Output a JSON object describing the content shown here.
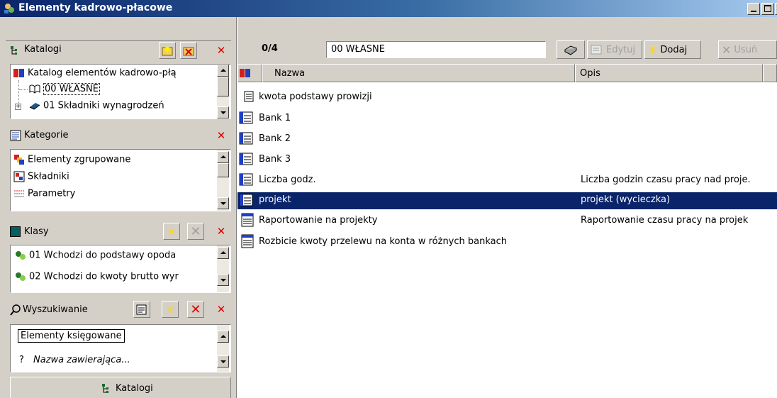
{
  "window": {
    "title": "Elementy kadrowo-płacowe",
    "controls": [
      "minimize",
      "maximize",
      "close"
    ]
  },
  "colors": {
    "titlebar": "#0a246a",
    "selection": "#0a246a",
    "delete": "#e00000"
  },
  "katalogi": {
    "header": "Katalogi",
    "tree": [
      {
        "label": "Katalog elementów kadrowo-płą",
        "icon": "catalog-icon"
      },
      {
        "label": "00 WŁASNE",
        "icon": "open-book-icon",
        "selected": true
      },
      {
        "label": "01 Składniki wynagrodzeń",
        "icon": "book-icon",
        "expander": "+"
      }
    ]
  },
  "kategorie": {
    "header": "Kategorie",
    "items": [
      {
        "label": "Elementy zgrupowane",
        "icon": "group-icon"
      },
      {
        "label": "Składniki",
        "icon": "component-icon"
      },
      {
        "label": "Parametry",
        "icon": "parameter-icon"
      }
    ]
  },
  "klasy": {
    "header": "Klasy",
    "items": [
      {
        "label": "01 Wchodzi do podstawy opoda"
      },
      {
        "label": "02 Wchodzi do kwoty brutto wyr"
      }
    ]
  },
  "wyszukiwanie": {
    "header": "Wyszukiwanie",
    "items": [
      {
        "label": "Elementy księgowane"
      },
      {
        "prefix": "?",
        "label": "Nazwa zawierająca..."
      }
    ]
  },
  "bottom_tab": {
    "label": "Katalogi"
  },
  "toolbar": {
    "counter": "0/4",
    "catalog_field": "00 WŁASNE",
    "edit_label": "Edytuj",
    "add_label": "Dodaj",
    "delete_label": "Usuń"
  },
  "grid": {
    "columns": {
      "name": "Nazwa",
      "desc": "Opis"
    },
    "rows": [
      {
        "name": "kwota podstawy prowizji",
        "desc": "",
        "icon": "document-icon"
      },
      {
        "name": "Bank 1",
        "desc": "",
        "icon": "grid-doc-icon"
      },
      {
        "name": "Bank 2",
        "desc": "",
        "icon": "grid-doc-icon"
      },
      {
        "name": "Bank 3",
        "desc": "",
        "icon": "grid-doc-icon"
      },
      {
        "name": "Liczba godz.",
        "desc": "Liczba godzin czasu pracy nad proje.",
        "icon": "grid-doc-icon"
      },
      {
        "name": "projekt",
        "desc": "projekt (wycieczka)",
        "icon": "grid-doc-icon",
        "selected": true
      },
      {
        "name": "Raportowanie na projekty",
        "desc": "Raportowanie czasu pracy na projek",
        "icon": "document-icon"
      },
      {
        "name": "Rozbicie kwoty przelewu na konta w różnych bankach",
        "desc": "",
        "icon": "document-icon"
      }
    ]
  }
}
